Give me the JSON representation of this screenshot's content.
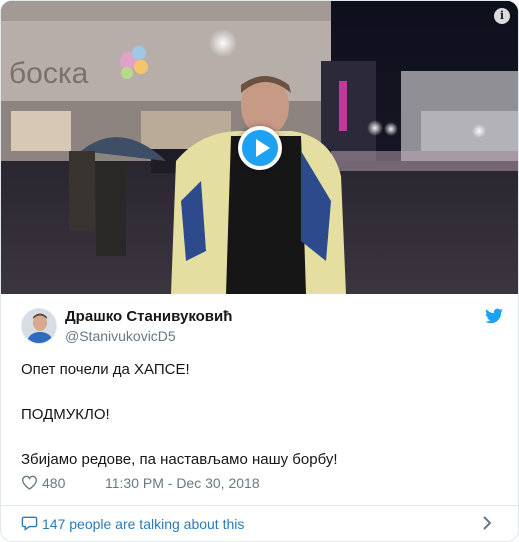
{
  "media": {
    "play_icon": "play-icon",
    "info_icon": "info-icon",
    "info_symbol": "i"
  },
  "author": {
    "display_name": "Драшко Станивуковић",
    "handle": "@StanivukovicD5",
    "avatar_icon": "avatar"
  },
  "tweet": {
    "lines": [
      "Опет почели да ХАПСЕ!",
      "ПОДМУКЛО!",
      "Збијамо редове, па настављамо нашу борбу!"
    ]
  },
  "meta": {
    "likes": "480",
    "timestamp": "11:30 PM - Dec 30, 2018",
    "heart_icon": "heart-icon"
  },
  "footer": {
    "talking_text": "147 people are talking about this",
    "comment_icon": "comment-icon",
    "chevron_icon": "chevron-right-icon"
  },
  "colors": {
    "twitter_blue": "#1da1f2",
    "link_blue": "#2b7bb9",
    "secondary_text": "#697882",
    "border": "#e1e8ed"
  }
}
